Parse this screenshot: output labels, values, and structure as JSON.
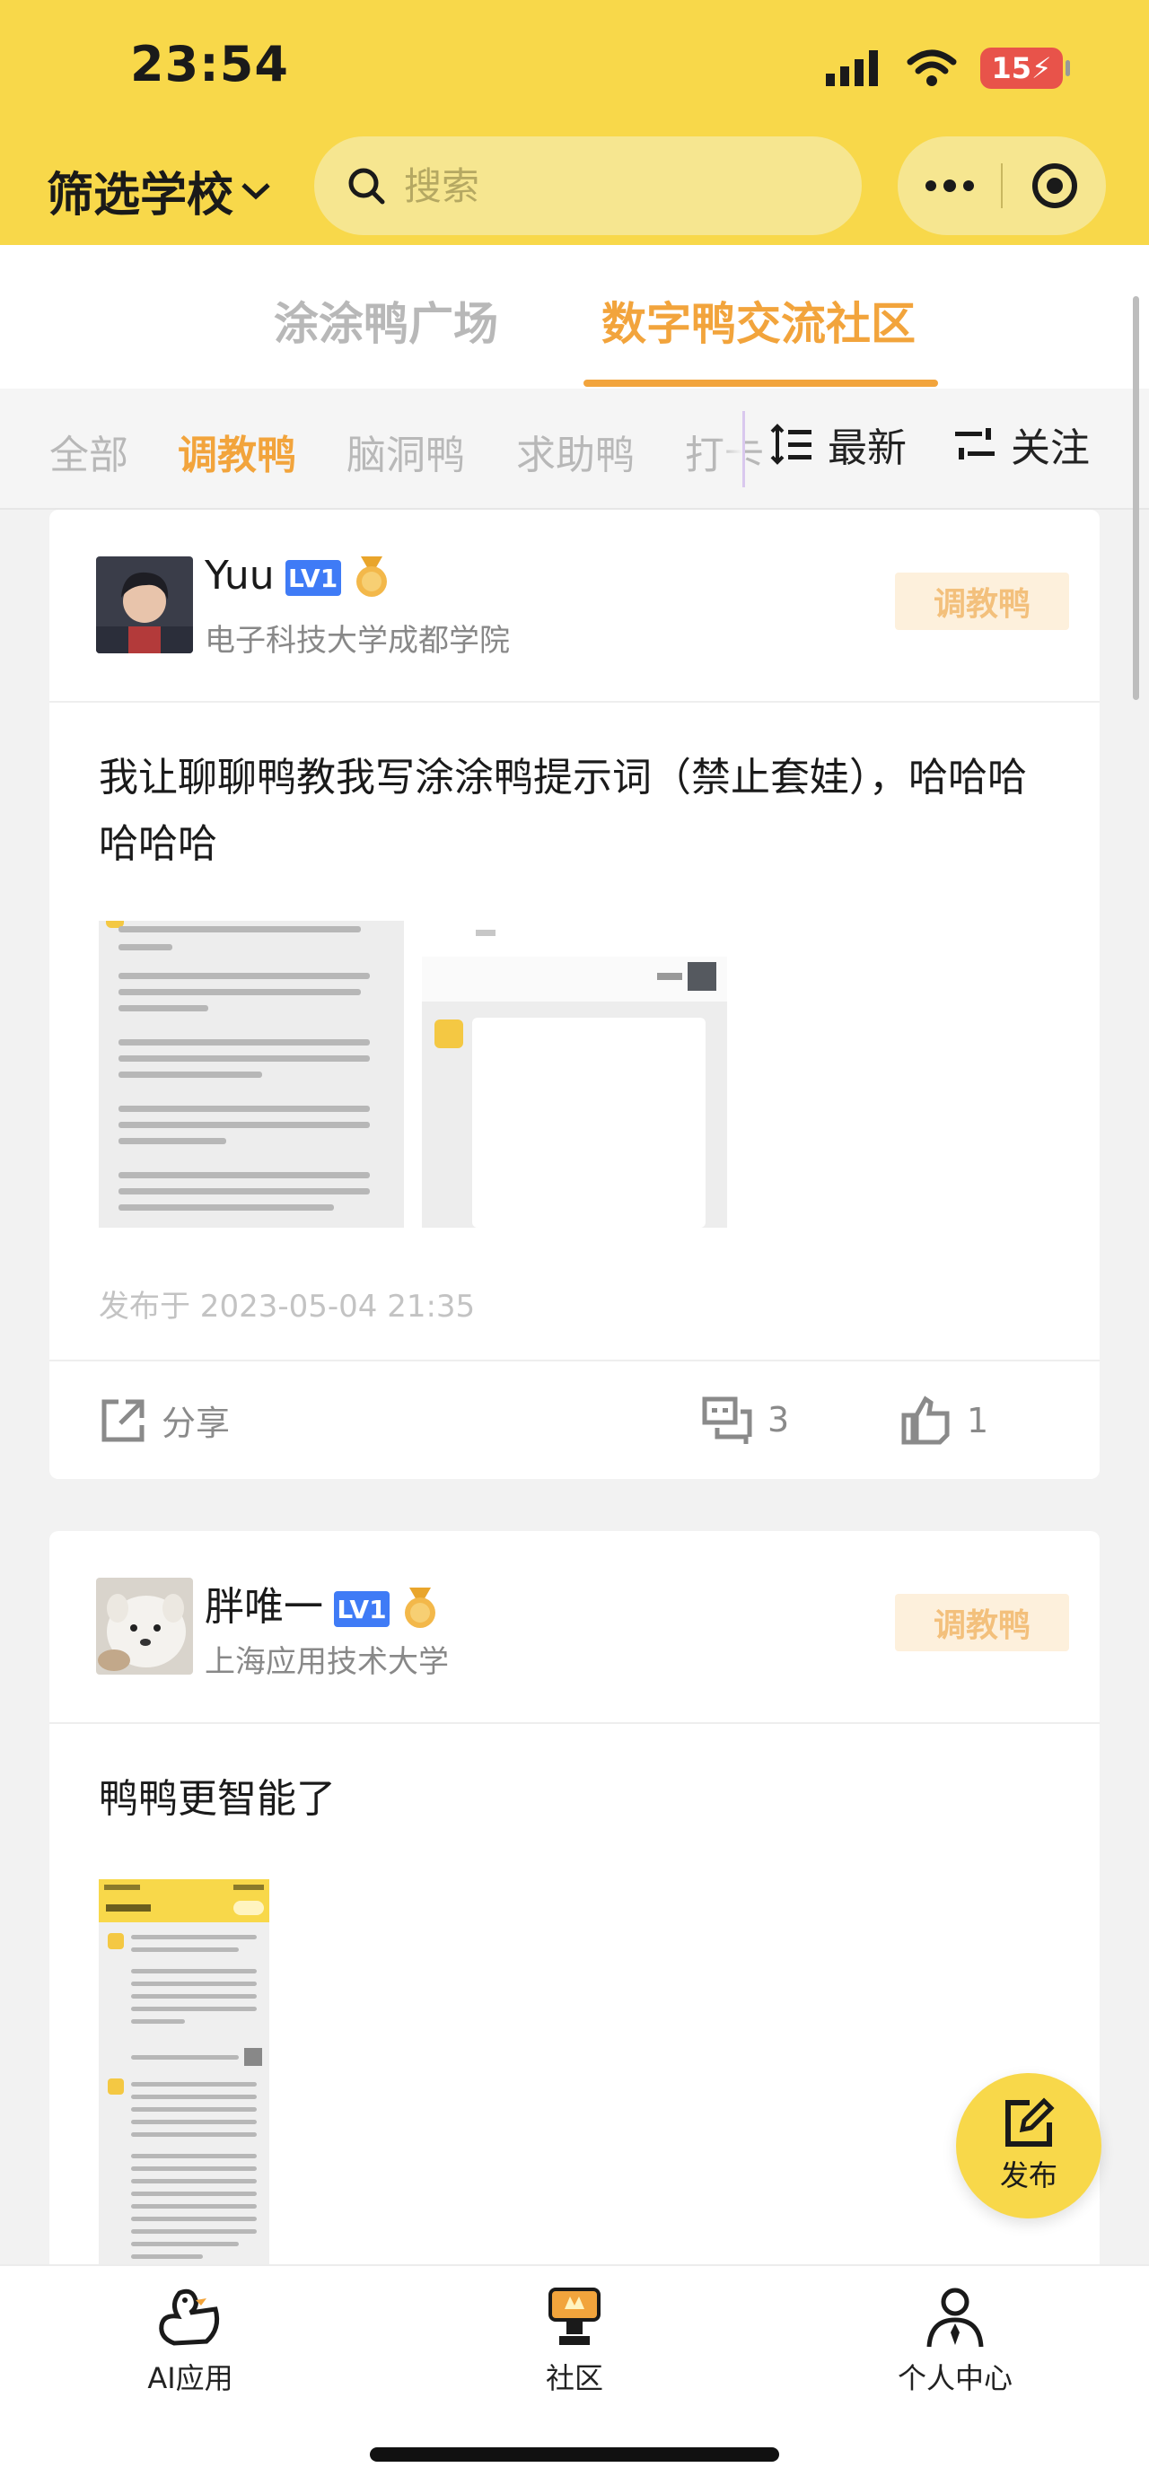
{
  "status_bar": {
    "time": "23:54",
    "battery": "15"
  },
  "header": {
    "school_filter_label": "筛选学校",
    "search_placeholder": "搜索"
  },
  "top_tabs": [
    {
      "label": "涂涂鸭广场",
      "active": false
    },
    {
      "label": "数字鸭交流社区",
      "active": true
    }
  ],
  "categories": [
    {
      "label": "全部",
      "active": false
    },
    {
      "label": "调教鸭",
      "active": true
    },
    {
      "label": "脑洞鸭",
      "active": false
    },
    {
      "label": "求助鸭",
      "active": false
    },
    {
      "label": "打卡",
      "active": false
    }
  ],
  "sort": {
    "latest_label": "最新",
    "follow_label": "关注"
  },
  "posts": [
    {
      "username": "Yuu",
      "level": "LV1",
      "school": "电子科技大学成都学院",
      "tag": "调教鸭",
      "text": "我让聊聊鸭教我写涂涂鸭提示词（禁止套娃），哈哈哈哈哈哈",
      "published": "发布于 2023-05-04 21:35",
      "share_label": "分享",
      "comments": "3",
      "likes": "1"
    },
    {
      "username": "胖唯一",
      "level": "LV1",
      "school": "上海应用技术大学",
      "tag": "调教鸭",
      "text": "鸭鸭更智能了"
    }
  ],
  "fab": {
    "label": "发布"
  },
  "bottom_nav": [
    {
      "label": "AI应用",
      "icon": "duck-icon"
    },
    {
      "label": "社区",
      "icon": "trophy-icon"
    },
    {
      "label": "个人中心",
      "icon": "person-icon"
    }
  ],
  "colors": {
    "brand_yellow": "#f8d84a",
    "accent_orange": "#f2a43c",
    "level_blue": "#3f7bf6"
  }
}
